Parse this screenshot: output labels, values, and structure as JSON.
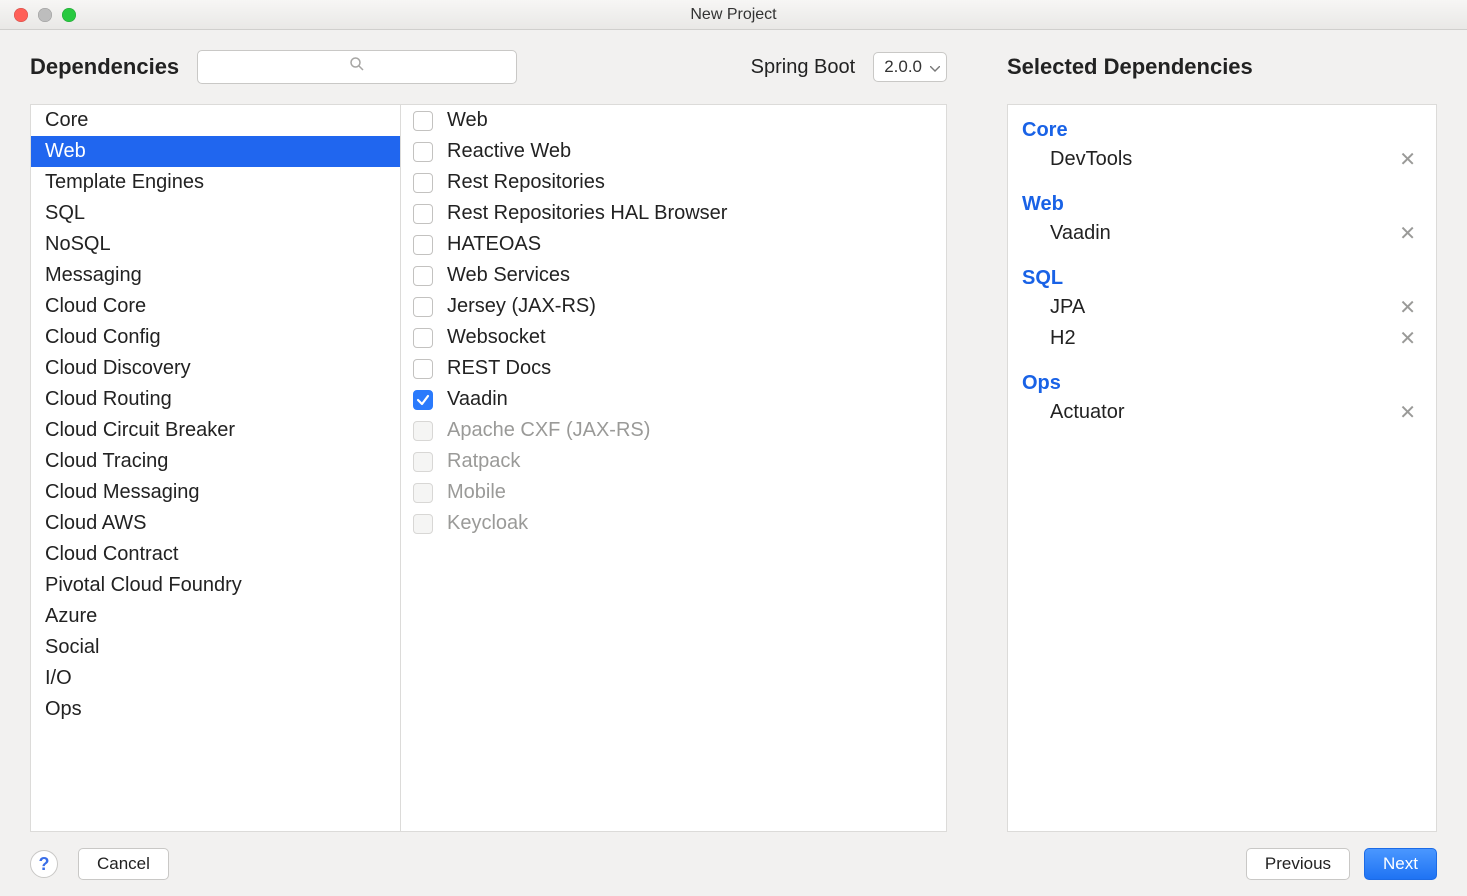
{
  "window_title": "New Project",
  "traffic_colors": {
    "close": "#ff5f57",
    "min": "#bdbdbd",
    "max": "#28c940"
  },
  "dependencies_label": "Dependencies",
  "search_placeholder": "",
  "spring_boot_label": "Spring Boot",
  "spring_boot_version": "2.0.0",
  "selected_deps_label": "Selected Dependencies",
  "categories": [
    "Core",
    "Web",
    "Template Engines",
    "SQL",
    "NoSQL",
    "Messaging",
    "Cloud Core",
    "Cloud Config",
    "Cloud Discovery",
    "Cloud Routing",
    "Cloud Circuit Breaker",
    "Cloud Tracing",
    "Cloud Messaging",
    "Cloud AWS",
    "Cloud Contract",
    "Pivotal Cloud Foundry",
    "Azure",
    "Social",
    "I/O",
    "Ops"
  ],
  "selected_category_index": 1,
  "dependency_items": [
    {
      "label": "Web",
      "checked": false,
      "enabled": true
    },
    {
      "label": "Reactive Web",
      "checked": false,
      "enabled": true
    },
    {
      "label": "Rest Repositories",
      "checked": false,
      "enabled": true
    },
    {
      "label": "Rest Repositories HAL Browser",
      "checked": false,
      "enabled": true
    },
    {
      "label": "HATEOAS",
      "checked": false,
      "enabled": true
    },
    {
      "label": "Web Services",
      "checked": false,
      "enabled": true
    },
    {
      "label": "Jersey (JAX-RS)",
      "checked": false,
      "enabled": true
    },
    {
      "label": "Websocket",
      "checked": false,
      "enabled": true
    },
    {
      "label": "REST Docs",
      "checked": false,
      "enabled": true
    },
    {
      "label": "Vaadin",
      "checked": true,
      "enabled": true
    },
    {
      "label": "Apache CXF (JAX-RS)",
      "checked": false,
      "enabled": false
    },
    {
      "label": "Ratpack",
      "checked": false,
      "enabled": false
    },
    {
      "label": "Mobile",
      "checked": false,
      "enabled": false
    },
    {
      "label": "Keycloak",
      "checked": false,
      "enabled": false
    }
  ],
  "selected_groups": [
    {
      "title": "Core",
      "items": [
        "DevTools"
      ]
    },
    {
      "title": "Web",
      "items": [
        "Vaadin"
      ]
    },
    {
      "title": "SQL",
      "items": [
        "JPA",
        "H2"
      ]
    },
    {
      "title": "Ops",
      "items": [
        "Actuator"
      ]
    }
  ],
  "footer": {
    "help": "?",
    "cancel": "Cancel",
    "previous": "Previous",
    "next": "Next"
  }
}
